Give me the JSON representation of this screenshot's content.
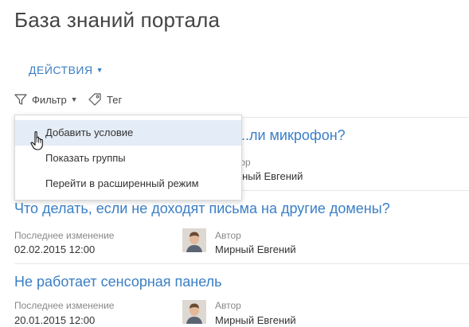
{
  "page": {
    "title": "База знаний портала"
  },
  "toolbar": {
    "actions_label": "ДЕЙСТВИЯ",
    "filter_label": "Фильтр",
    "tag_label": "Тег"
  },
  "dropdown": {
    "items": [
      {
        "label": "Добавить условие"
      },
      {
        "label": "Показать группы"
      },
      {
        "label": "Перейти в расширенный режим"
      }
    ]
  },
  "articles": [
    {
      "title": "...ли микрофон?",
      "author_label": "...тор",
      "author": "...рный Евгений"
    },
    {
      "title": "Что делать, если не доходят письма на другие домены?",
      "modified_label": "Последнее изменение",
      "modified": "02.02.2015 12:00",
      "author_label": "Автор",
      "author": "Мирный Евгений"
    },
    {
      "title": "Не работает сенсорная панель",
      "modified_label": "Последнее изменение",
      "modified": "20.01.2015 12:00",
      "author_label": "Автор",
      "author": "Мирный Евгений"
    }
  ],
  "colors": {
    "accent": "#3a7fc6",
    "hover": "#e4ecf7"
  },
  "icons": [
    "funnel-icon",
    "tag-icon",
    "hand-cursor-icon",
    "chevron-down-icon"
  ]
}
